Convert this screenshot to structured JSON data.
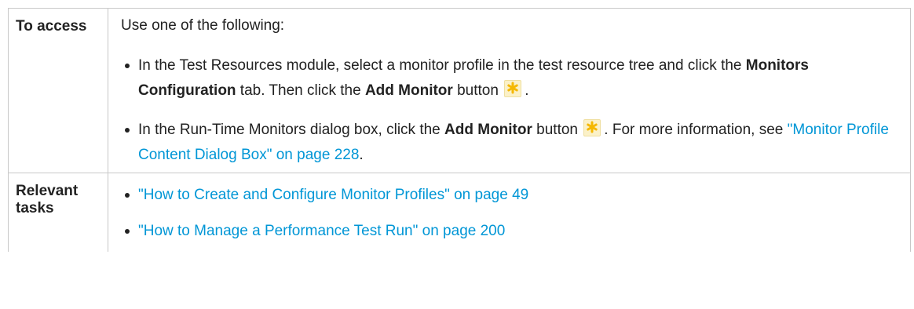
{
  "table": {
    "rows": [
      {
        "label": "To access",
        "intro": "Use one of the following:",
        "bullets": [
          {
            "t1": "In the Test Resources module, select a monitor profile in the test resource tree and click the ",
            "b1": "Monitors Configuration",
            "t2": " tab. Then click the ",
            "b2": "Add Monitor",
            "t3": " button ",
            "icon": "add-monitor-asterisk-icon",
            "t4": "."
          },
          {
            "t1": "In the Run-Time Monitors dialog box, click the ",
            "b1": "Add Monitor",
            "t2": " button ",
            "icon": "add-monitor-asterisk-icon",
            "t3": ". For more information, see ",
            "link": "\"Monitor Profile Content Dialog Box\" on page 228",
            "t4": "."
          }
        ]
      },
      {
        "label": "Relevant tasks",
        "links": [
          "\"How to Create and Configure Monitor Profiles\" on page 49",
          "\"How to Manage a Performance Test Run\" on page 200"
        ]
      }
    ]
  },
  "colors": {
    "link": "#0096d6",
    "border": "#c8c8c8",
    "icon_star": "#f5b800"
  }
}
